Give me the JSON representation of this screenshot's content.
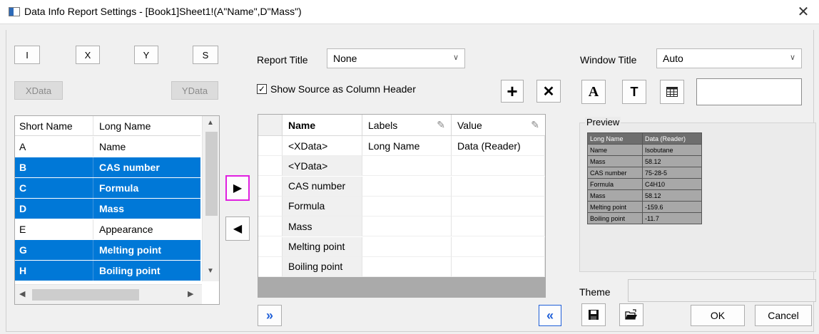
{
  "window": {
    "title": "Data Info Report Settings - [Book1]Sheet1!(A\"Name\",D\"Mass\")",
    "close": "✕"
  },
  "left_buttons": {
    "i": "I",
    "x": "X",
    "y": "Y",
    "s": "S",
    "xdata": "XData",
    "ydata": "YData"
  },
  "left_grid": {
    "headers": {
      "short": "Short Name",
      "long": "Long Name"
    },
    "rows": [
      {
        "short": "A",
        "long": "Name",
        "selected": false
      },
      {
        "short": "B",
        "long": "CAS number",
        "selected": true
      },
      {
        "short": "C",
        "long": "Formula",
        "selected": true
      },
      {
        "short": "D",
        "long": "Mass",
        "selected": true
      },
      {
        "short": "E",
        "long": "Appearance",
        "selected": false
      },
      {
        "short": "G",
        "long": "Melting point",
        "selected": true
      },
      {
        "short": "H",
        "long": "Boiling point",
        "selected": true
      }
    ]
  },
  "arrows": {
    "add": "▶",
    "remove": "◀"
  },
  "report": {
    "title_label": "Report Title",
    "title_value": "None",
    "show_source_label": "Show Source as Column Header",
    "show_source_checked": true,
    "plus": "+",
    "times": "✕"
  },
  "mid_grid": {
    "headers": {
      "name": "Name",
      "labels": "Labels",
      "value": "Value"
    },
    "rows": [
      {
        "name": "<XData>",
        "labels": "Long Name",
        "value": "Data (Reader)"
      },
      {
        "name": "<YData>",
        "labels": "",
        "value": ""
      },
      {
        "name": "CAS number",
        "labels": "",
        "value": ""
      },
      {
        "name": "Formula",
        "labels": "",
        "value": ""
      },
      {
        "name": "Mass",
        "labels": "",
        "value": ""
      },
      {
        "name": "Melting point",
        "labels": "",
        "value": ""
      },
      {
        "name": "Boiling point",
        "labels": "",
        "value": ""
      }
    ]
  },
  "bottom_mid": {
    "expand": "»",
    "collapse": "«"
  },
  "window_title": {
    "label": "Window Title",
    "value": "Auto"
  },
  "format": {
    "a": "A",
    "t": "T",
    "table_icon": "table-icon"
  },
  "preview": {
    "label": "Preview",
    "table": [
      [
        "Long Name",
        "Data (Reader)"
      ],
      [
        "Name",
        "Isobutane"
      ],
      [
        "Mass",
        "58.12"
      ],
      [
        "CAS number",
        "75-28-5"
      ],
      [
        "Formula",
        "C4H10"
      ],
      [
        "Mass",
        "58.12"
      ],
      [
        "Melting point",
        "-159.6"
      ],
      [
        "Boiling point",
        "-11.7"
      ]
    ]
  },
  "theme": {
    "label": "Theme",
    "value": ""
  },
  "footer": {
    "ok": "OK",
    "cancel": "Cancel",
    "save_icon": "save-icon",
    "open_icon": "open-folder-icon"
  },
  "colors": {
    "selection": "#0078d7",
    "focus_border": "#e020e0",
    "blue_arrow": "#1f5fd8"
  }
}
